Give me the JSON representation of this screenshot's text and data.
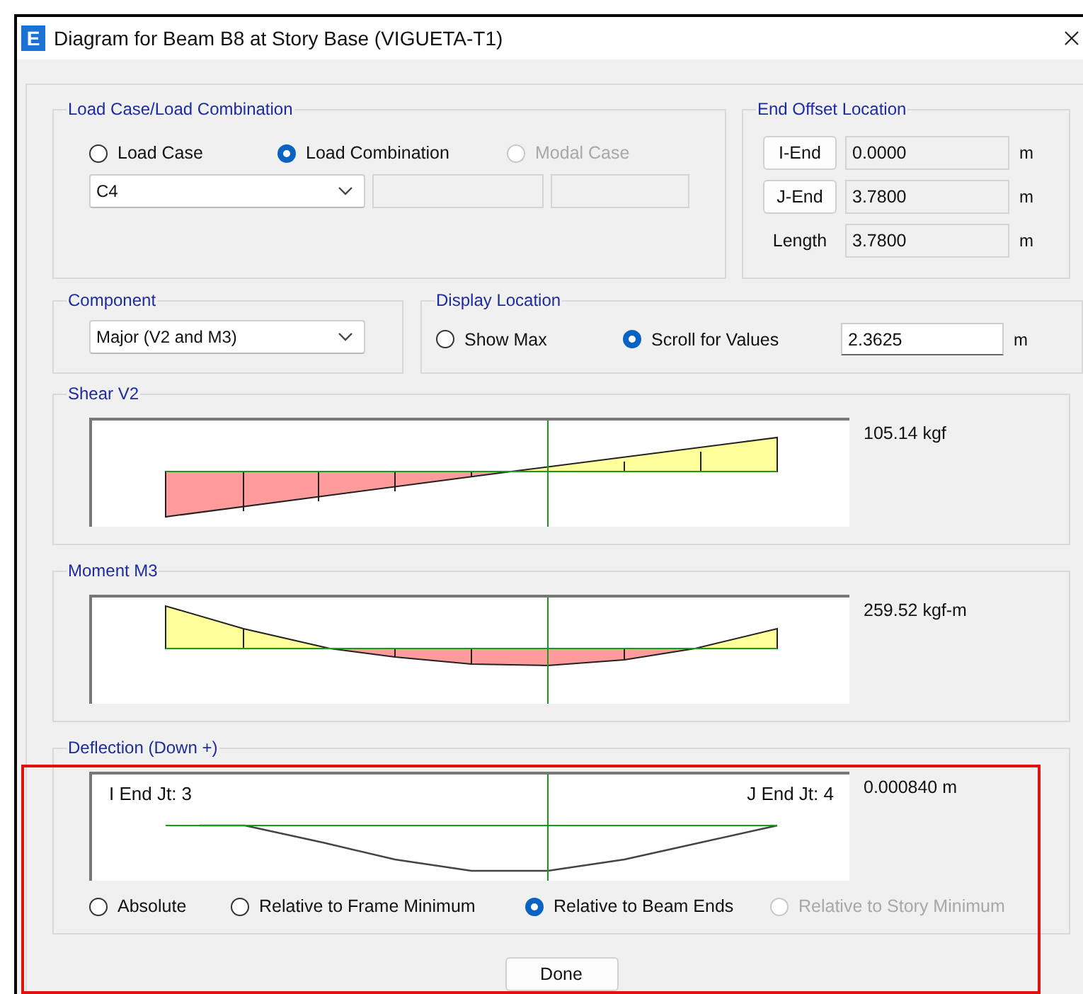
{
  "window": {
    "app_icon_letter": "E",
    "title": "Diagram for Beam B8 at Story Base (VIGUETA-T1)"
  },
  "load_case": {
    "title": "Load Case/Load Combination",
    "options": [
      {
        "label": "Load Case",
        "selected": false,
        "disabled": false
      },
      {
        "label": "Load Combination",
        "selected": true,
        "disabled": false
      },
      {
        "label": "Modal Case",
        "selected": false,
        "disabled": true
      }
    ],
    "combination": {
      "value": "C4"
    }
  },
  "end_offset": {
    "title": "End Offset Location",
    "rows": [
      {
        "kind": "button",
        "label": "I-End",
        "value": "0.0000",
        "unit": "m"
      },
      {
        "kind": "button",
        "label": "J-End",
        "value": "3.7800",
        "unit": "m"
      },
      {
        "kind": "text",
        "label": "Length",
        "value": "3.7800",
        "unit": "m"
      }
    ]
  },
  "component": {
    "title": "Component",
    "value": "Major (V2 and M3)"
  },
  "display_location": {
    "title": "Display Location",
    "options": [
      {
        "label": "Show Max",
        "selected": false
      },
      {
        "label": "Scroll for Values",
        "selected": true
      }
    ],
    "value": "2.3625",
    "unit": "m"
  },
  "diagrams": [
    {
      "kind": "shear",
      "title": "Shear V2",
      "max_value": "105.14 kgf"
    },
    {
      "kind": "moment",
      "title": "Moment M3",
      "max_value": "259.52 kgf-m"
    },
    {
      "kind": "deflection",
      "title": "Deflection (Down +)",
      "max_value": "0.000840 m",
      "i_end_label": "I End Jt: 3",
      "j_end_label": "J End Jt: 4",
      "options": [
        {
          "label": "Absolute",
          "selected": false,
          "disabled": false
        },
        {
          "label": "Relative to Frame Minimum",
          "selected": false,
          "disabled": false
        },
        {
          "label": "Relative to Beam Ends",
          "selected": true,
          "disabled": false
        },
        {
          "label": "Relative to Story Minimum",
          "selected": false,
          "disabled": true
        }
      ]
    }
  ],
  "buttons": [
    {
      "label": "Done"
    }
  ]
}
